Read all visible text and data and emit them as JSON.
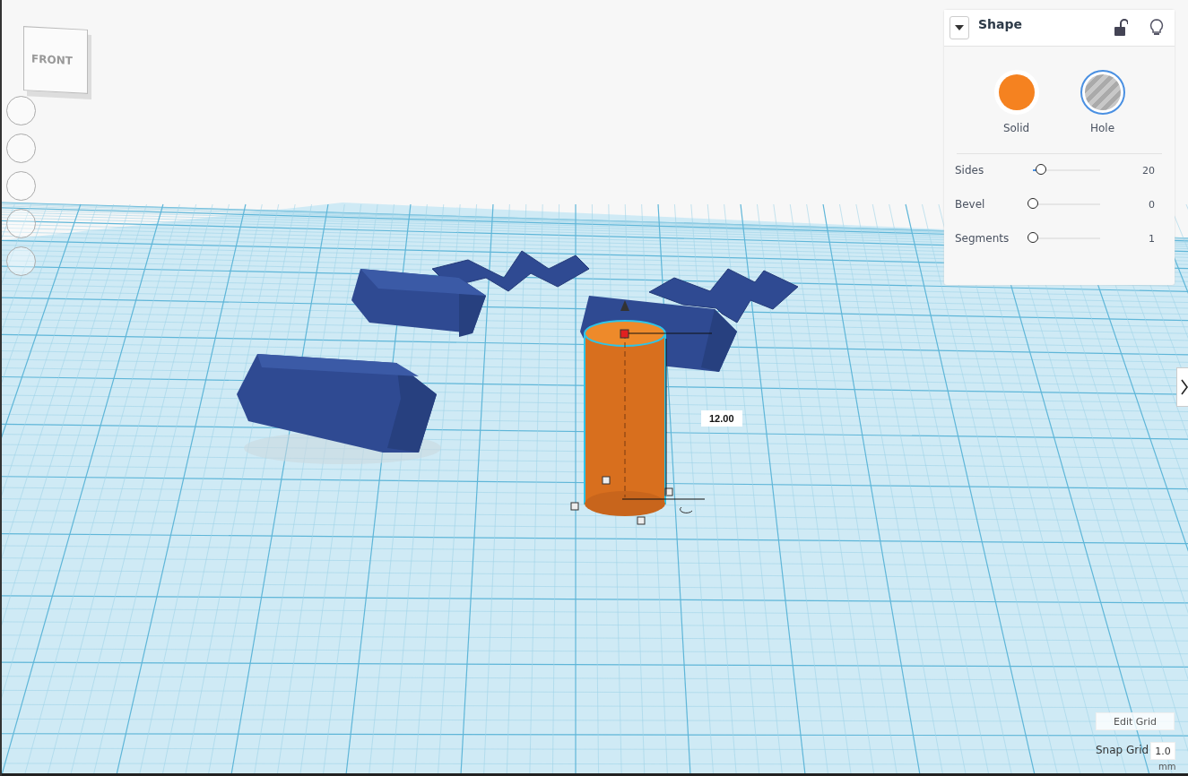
{
  "view_cube": {
    "front_label": "FRONT"
  },
  "view_buttons": [
    {
      "kind": "circle"
    },
    {
      "kind": "circle"
    },
    {
      "kind": "circle"
    },
    {
      "kind": "circle"
    },
    {
      "kind": "circle"
    }
  ],
  "workplane": {
    "dimension_label": "12.00"
  },
  "shape_panel": {
    "title": "Shape",
    "modes": [
      {
        "label": "Solid",
        "kind": "solid",
        "selected": false
      },
      {
        "label": "Hole",
        "kind": "hole",
        "selected": true
      }
    ],
    "sliders": [
      {
        "label": "Sides",
        "level": 0.1,
        "reading": "20"
      },
      {
        "label": "Bevel",
        "level": 0,
        "reading": "0"
      },
      {
        "label": "Segments",
        "level": 0,
        "reading": "1"
      }
    ]
  },
  "grid_controls": {
    "edit_button": "Edit Grid",
    "snap_label": "Snap Grid",
    "snap_value": "1.0",
    "unit": "mm"
  }
}
